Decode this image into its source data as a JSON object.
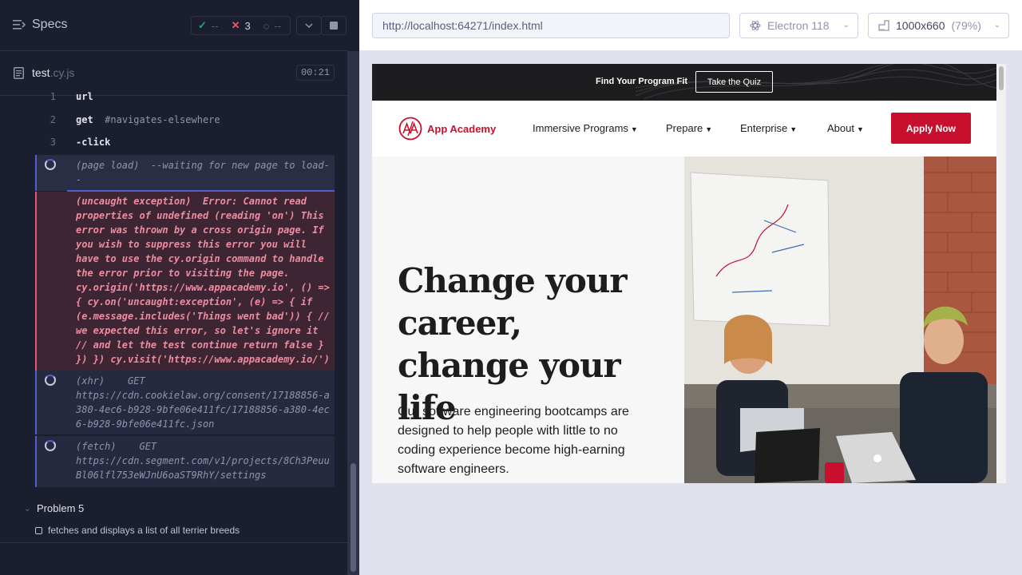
{
  "reporter": {
    "specs_label": "Specs",
    "stats": {
      "passed": "--",
      "failed": "3",
      "pending": "--"
    },
    "spec_file": {
      "name": "test",
      "ext": ".cy.js",
      "duration": "00:21"
    },
    "commands": [
      {
        "num": "1",
        "name": "url",
        "selector": ""
      },
      {
        "num": "2",
        "name": "get",
        "selector": "#navigates-elsewhere"
      },
      {
        "num": "3",
        "name": "-click",
        "selector": ""
      }
    ],
    "page_load": "(page load)  --waiting for new page to load--",
    "error": "(uncaught exception)  Error: Cannot read properties of undefined (reading 'on') This error was thrown by a cross origin page. If you wish to suppress this error you will have to use the cy.origin command to handle the error prior to visiting the page. cy.origin('https://www.appacademy.io', () => { cy.on('uncaught:exception', (e) => { if (e.message.includes('Things went bad')) { // we expected this error, so let's ignore it // and let the test continue return false } }) }) cy.visit('https://www.appacademy.io/')",
    "xhr": "(xhr)    GET\nhttps://cdn.cookielaw.org/consent/17188856-a380-4ec6-b928-9bfe06e411fc/17188856-a380-4ec6-b928-9bfe06e411fc.json",
    "fetch": "(fetch)    GET\nhttps://cdn.segment.com/v1/projects/8Ch3PeuuBl06lfl753eWJnU6oaST9RhY/settings",
    "problem_title": "Problem 5",
    "test_title": "fetches and displays a list of all terrier breeds"
  },
  "aut": {
    "url": "http://localhost:64271/index.html",
    "browser": "Electron 118",
    "viewport": "1000x660",
    "zoom": "(79%)"
  },
  "site": {
    "promo_text": "Find Your Program Fit",
    "quiz_label": "Take the Quiz",
    "logo_text": "App Academy",
    "nav": [
      "Immersive Programs",
      "Prepare",
      "Enterprise",
      "About"
    ],
    "apply_label": "Apply Now",
    "hero_title": "Change your career, change your life",
    "hero_sub": "Our software engineering bootcamps are designed to help people with little to no coding experience become high-earning software engineers."
  },
  "colors": {
    "reporter_bg": "#1b1e2e",
    "error_bg": "#3d2533",
    "error_text": "#f08ca0",
    "accent_blue": "#4f5fd0",
    "brand_red": "#c8102e",
    "pass_green": "#1fa971",
    "fail_red": "#e45770"
  }
}
